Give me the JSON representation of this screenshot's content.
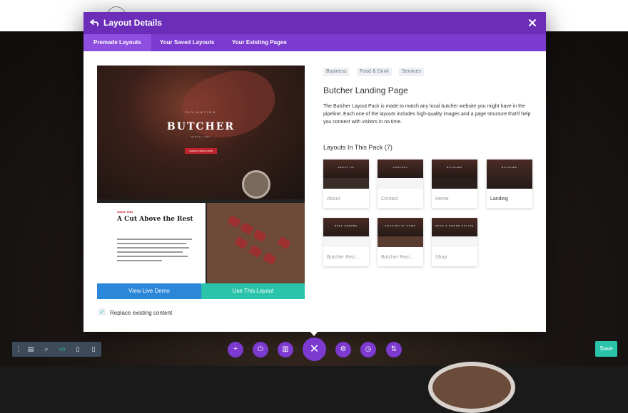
{
  "modal": {
    "title": "Layout Details",
    "tabs": [
      {
        "label": "Premade Layouts",
        "active": true
      },
      {
        "label": "Your Saved Layouts",
        "active": false
      },
      {
        "label": "Your Existing Pages",
        "active": false
      }
    ]
  },
  "preview": {
    "hero_kicker": "DIVINATION",
    "hero_title": "BUTCHER",
    "hero_sub": "SINCE 1984",
    "hero_button": "COME IN, WE'RE OPEN",
    "section_kicker": "SINCE 1984",
    "section_title": "A Cut Above the Rest",
    "view_demo_label": "View Live Demo",
    "use_layout_label": "Use This Layout",
    "replace_label": "Replace existing content",
    "replace_checked": true
  },
  "details": {
    "tags": [
      "Business",
      "Food & Drink",
      "Services"
    ],
    "title": "Butcher Landing Page",
    "description": "The Butcher Layout Pack is made to match any local butcher website you might have in the pipeline. Each one of the layouts includes high-quality images and a page structure that'll help you connect with visitors in no time.",
    "pack_title": "Layouts In This Pack (7)",
    "layouts": [
      {
        "label": "About",
        "caption": "ABOUT US"
      },
      {
        "label": "Contact",
        "caption": "CONTACT"
      },
      {
        "label": "Home",
        "caption": "BUTCHER"
      },
      {
        "label": "Landing",
        "caption": "BUTCHER",
        "selected": true
      },
      {
        "label": "Butcher Reci...",
        "caption": "BEEF KEBOBS"
      },
      {
        "label": "Butcher Reci...",
        "caption": "COOKING AT HOME"
      },
      {
        "label": "Shop",
        "caption": "SHOP & ORDER ONLINE"
      }
    ]
  },
  "toolbar": {
    "icons": [
      "menu-dots-icon",
      "layers-icon",
      "zoom-icon",
      "desktop-icon",
      "tablet-icon",
      "phone-icon"
    ],
    "actions": [
      "add-icon",
      "power-icon",
      "trash-icon",
      "close-icon",
      "settings-icon",
      "history-icon",
      "sort-icon"
    ],
    "save_label": "Save"
  },
  "colors": {
    "purple_header": "#6c2eb9",
    "purple_tabs": "#7c3ad0",
    "blue_button": "#2b87da",
    "teal_button": "#29c4a9",
    "toolbar_gray": "#3d4a5a"
  }
}
